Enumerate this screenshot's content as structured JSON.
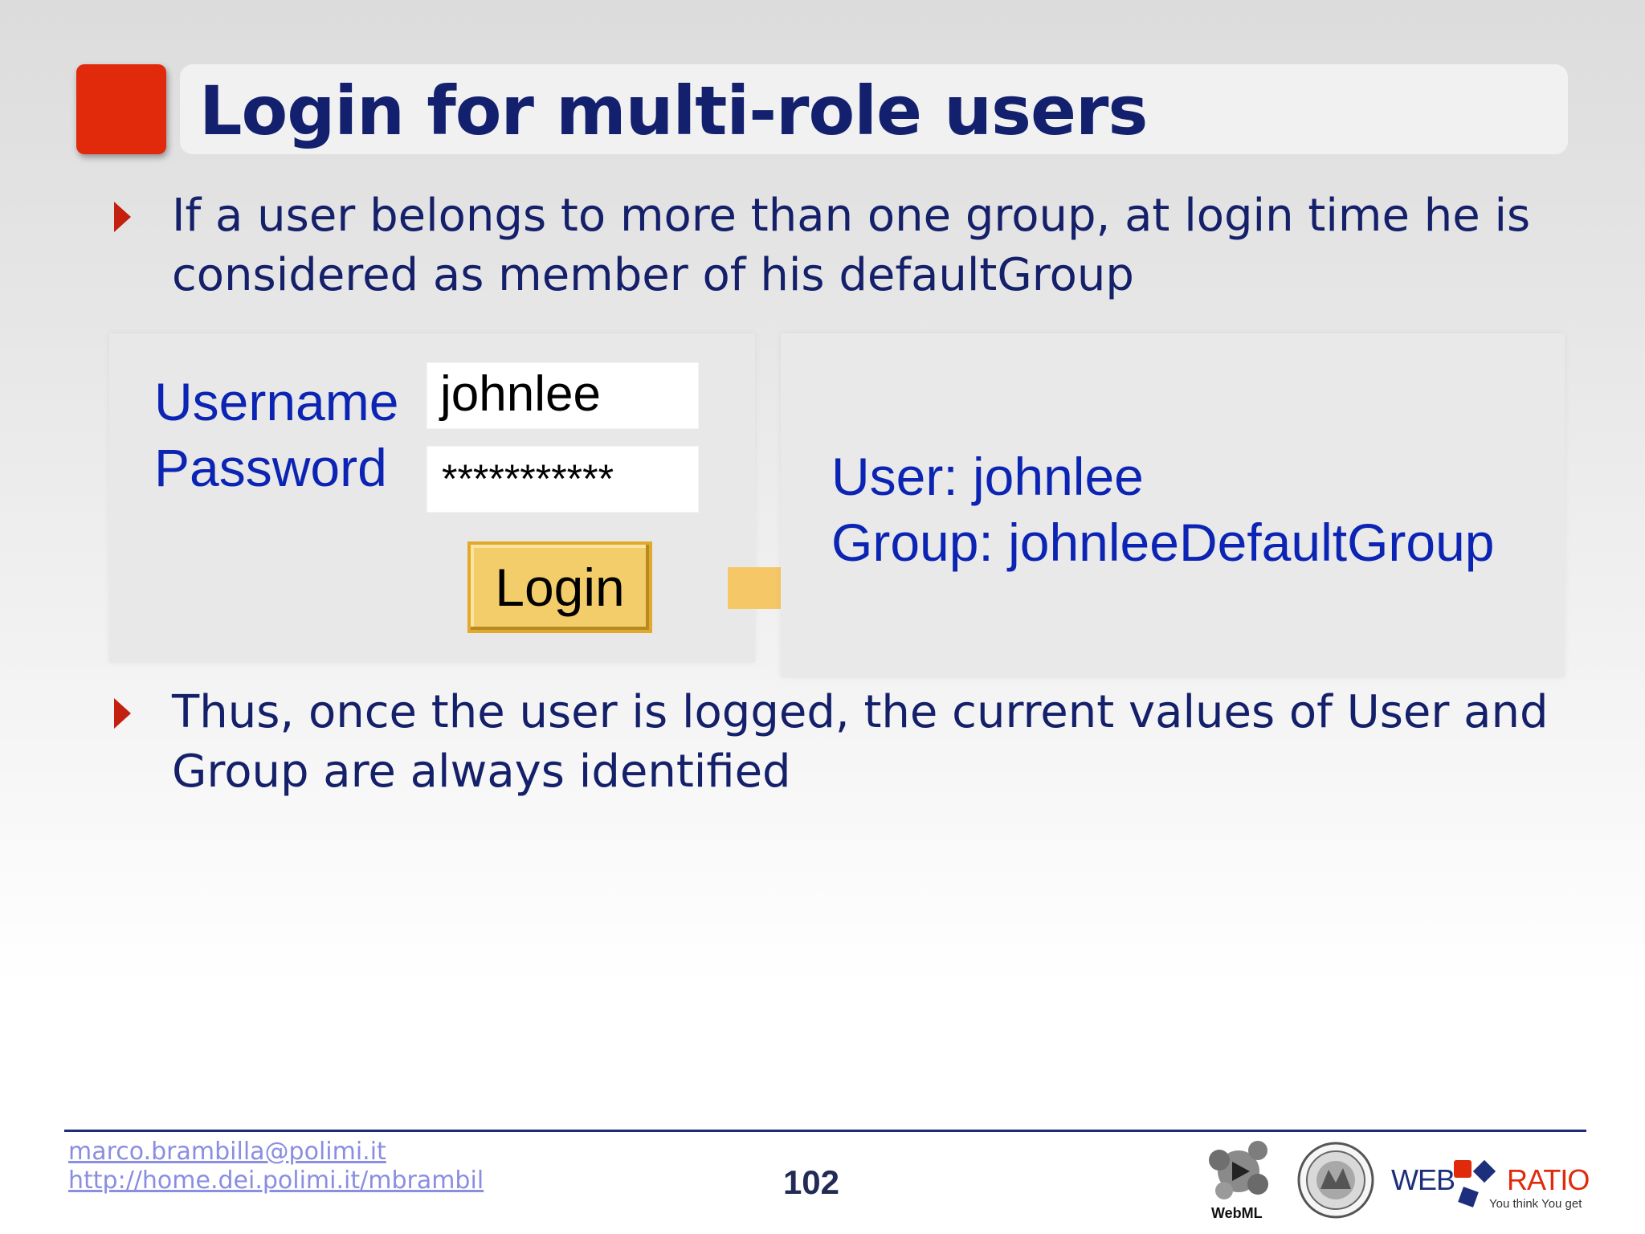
{
  "title": "Login for multi-role users",
  "bullets": [
    "If a user belongs to more than one group, at login time he is considered as member of his defaultGroup",
    "Thus, once the user is logged, the current values of User and Group are always identified"
  ],
  "login_form": {
    "username_label": "Username",
    "username_value": "johnlee",
    "password_label": "Password",
    "password_value": "***********",
    "login_button": "Login"
  },
  "result": {
    "user_line": "User: johnlee",
    "group_line": "Group: johnleeDefaultGroup"
  },
  "footer": {
    "email": "marco.brambilla@polimi.it",
    "homepage": "http://home.dei.polimi.it/mbrambil",
    "page_number": "102",
    "webml_logo_text": "WebML",
    "webratio_web": "WEB",
    "webratio_ratio": "RATIO",
    "webratio_tagline": "You think You get"
  },
  "colors": {
    "accent_red": "#e12a0c",
    "title_navy": "#13206e",
    "label_blue": "#0c24b4",
    "button_gold": "#f3cd6a",
    "arrow_gold": "#f6c767"
  }
}
